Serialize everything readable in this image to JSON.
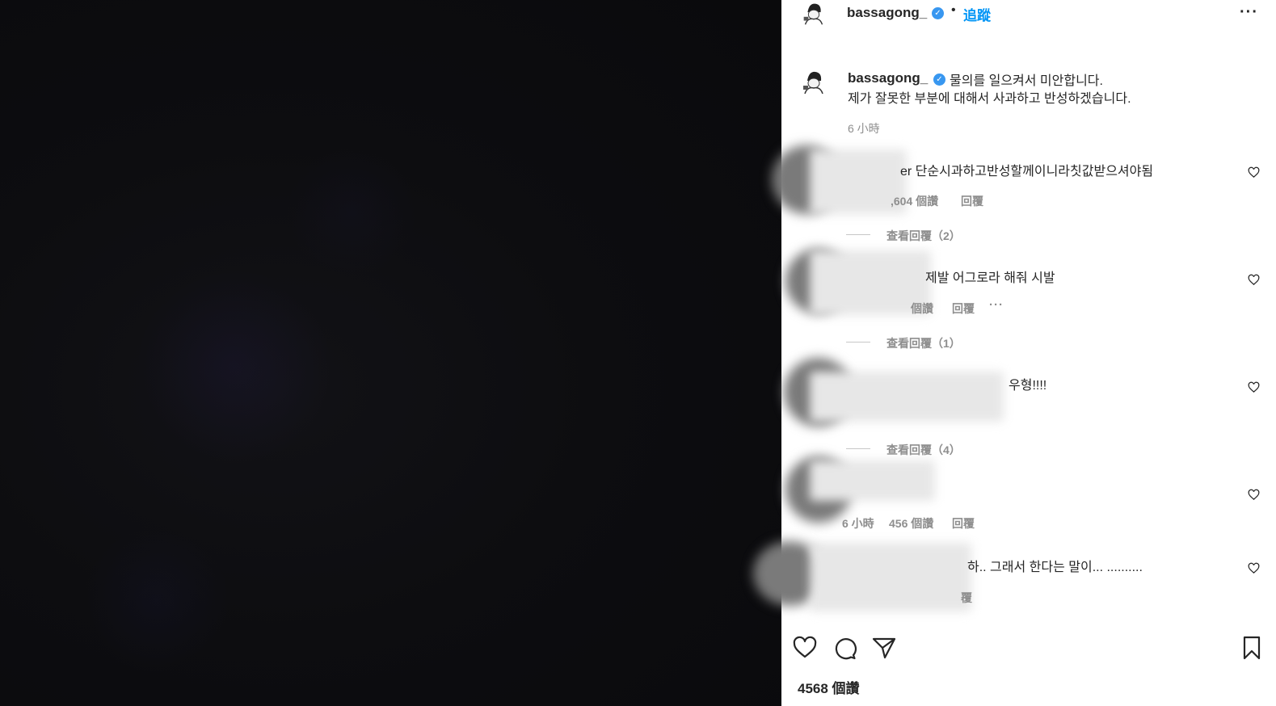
{
  "header": {
    "username": "bassagong_",
    "verified_mark": "✓",
    "separator": "•",
    "follow_label": "追蹤",
    "more_label": "···"
  },
  "caption": {
    "username": "bassagong_",
    "verified_mark": "✓",
    "line1": "물의를 일으켜서 미안합니다.",
    "line2": "제가 잘못한 부분에 대해서 사과하고 반성하겠습니다.",
    "time": "6 小時"
  },
  "comments": [
    {
      "text": "er 단순시과하고반성할께이니라칫값받으셔야됨",
      "likes": ",604 個讚",
      "reply_label": "回覆",
      "view_replies": "查看回覆（2）"
    },
    {
      "text": "제발 어그로라 해줘 시발",
      "likes": "個讚",
      "reply_label": "回覆",
      "more_label": "···",
      "view_replies": "查看回覆（1）"
    },
    {
      "text": "우형!!!!",
      "view_replies": "查看回覆（4）"
    },
    {
      "time": "6 小時",
      "likes": "456 個讚",
      "reply_label": "回覆"
    },
    {
      "text": "하.. 그래서 한다는 말이... ..........",
      "reply_label": "覆"
    }
  ],
  "footer": {
    "likes": "4568 個讚"
  },
  "icons": {
    "like": "heart-icon",
    "comment": "comment-icon",
    "share": "share-icon",
    "save": "bookmark-icon"
  }
}
